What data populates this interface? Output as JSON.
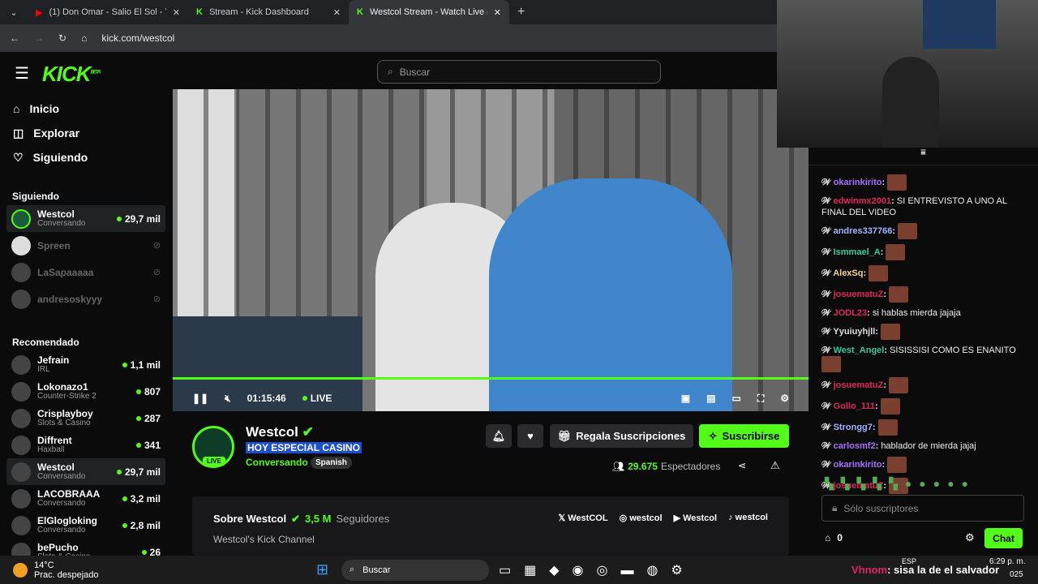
{
  "browser": {
    "tabs": [
      {
        "title": "(1) Don Omar - Salio El Sol - Yo",
        "icon": "youtube-icon"
      },
      {
        "title": "Stream - Kick Dashboard",
        "icon": "kick-icon"
      },
      {
        "title": "Westcol Stream - Watch Live on Kick",
        "icon": "kick-icon"
      }
    ],
    "url": "kick.com/westcol"
  },
  "header": {
    "logo": "KICK",
    "beta": "BETA",
    "search_placeholder": "Buscar"
  },
  "sidebar": {
    "nav": [
      {
        "label": "Inicio",
        "icon": "home-icon"
      },
      {
        "label": "Explorar",
        "icon": "compass-icon"
      },
      {
        "label": "Siguiendo",
        "icon": "heart-icon"
      }
    ],
    "following_title": "Siguiendo",
    "following": [
      {
        "name": "Westcol",
        "category": "Conversando",
        "viewers": "29,7 mil",
        "live": true
      },
      {
        "name": "Spreen",
        "live": false
      },
      {
        "name": "LaSapaaaaa",
        "live": false
      },
      {
        "name": "andresoskyyy",
        "live": false
      }
    ],
    "recommended_title": "Recomendado",
    "recommended": [
      {
        "name": "Jefrain",
        "category": "IRL",
        "viewers": "1,1 mil"
      },
      {
        "name": "Lokonazo1",
        "category": "Counter-Strike 2",
        "viewers": "807"
      },
      {
        "name": "Crisplayboy",
        "category": "Slots & Casino",
        "viewers": "287"
      },
      {
        "name": "Diffrent",
        "category": "Haxball",
        "viewers": "341"
      },
      {
        "name": "Westcol",
        "category": "Conversando",
        "viewers": "29,7 mil"
      },
      {
        "name": "LACOBRAAA",
        "category": "Conversando",
        "viewers": "3,2 mil"
      },
      {
        "name": "ElGlogloking",
        "category": "Conversando",
        "viewers": "2,8 mil"
      },
      {
        "name": "bePucho",
        "category": "Slots & Casino",
        "viewers": "26"
      }
    ]
  },
  "player": {
    "time": "01:15:46",
    "live": "LIVE",
    "progress_percent": 100
  },
  "stream": {
    "channel": "Westcol",
    "title": "HOY ESPECIAL CASINO",
    "category": "Conversando",
    "language": "Spanish",
    "live_badge": "LIVE",
    "gift_label": "Regala Suscripciones",
    "subscribe_label": "Suscribirse",
    "viewers": "29.675",
    "viewers_label": "Espectadores"
  },
  "about": {
    "title": "Sobre Westcol",
    "followers": "3,5 M",
    "followers_label": "Seguidores",
    "description": "Westcol's Kick Channel",
    "socials": [
      {
        "icon": "x-icon",
        "label": "WestCOL"
      },
      {
        "icon": "instagram-icon",
        "label": "westcol"
      },
      {
        "icon": "youtube-icon",
        "label": "Westcol"
      },
      {
        "icon": "tiktok-icon",
        "label": "westcol"
      }
    ]
  },
  "chat": {
    "messages": [
      {
        "user": "okarinkirito",
        "color": "#a970ff",
        "text": "",
        "emote": true
      },
      {
        "user": "edwinmx2001",
        "color": "#e0245e",
        "text": "SI ENTREVISTO A UNO AL FINAL DEL VIDEO",
        "emote": false
      },
      {
        "user": "andres337766",
        "color": "#a0b4ff",
        "text": "",
        "emote": true
      },
      {
        "user": "Ismmael_A",
        "color": "#2ecc9a",
        "text": "",
        "emote": true
      },
      {
        "user": "AlexSq",
        "color": "#f5d08a",
        "text": "",
        "emote": true
      },
      {
        "user": "josuematuZ",
        "color": "#e0245e",
        "text": "",
        "emote": true
      },
      {
        "user": "JODL23",
        "color": "#e0245e",
        "text": "si hablas mierda jajaja",
        "emote": false
      },
      {
        "user": "Yyuiuyhjll",
        "color": "#ddd",
        "text": "",
        "emote": true
      },
      {
        "user": "West_Angel",
        "color": "#2ecc9a",
        "text": "SISISSISI COMO ES ENANITO",
        "emote": true
      },
      {
        "user": "josuematuZ",
        "color": "#e0245e",
        "text": "",
        "emote": true
      },
      {
        "user": "Gollo_111",
        "color": "#e0245e",
        "text": "",
        "emote": true
      },
      {
        "user": "Strongg7",
        "color": "#a0b4ff",
        "text": "",
        "emote": true
      },
      {
        "user": "carlosmf2",
        "color": "#a970ff",
        "text": "hablador de mierda jajaj",
        "emote": false
      },
      {
        "user": "okarinkirito",
        "color": "#a970ff",
        "text": "",
        "emote": true
      },
      {
        "user": "josuematuZ",
        "color": "#e0245e",
        "text": "",
        "emote": true
      }
    ],
    "input_placeholder": "Sólo suscriptores",
    "points": "0",
    "send_label": "Chat"
  },
  "taskbar": {
    "weather_temp": "14°C",
    "weather_desc": "Prac. despejado",
    "search": "Buscar",
    "lang": "ESP",
    "time": "6:29 p. m.",
    "date_partial": "025",
    "overlay_user": "Vhnom",
    "overlay_text": ": sisa la de el salvador"
  },
  "colors": {
    "accent": "#53fc18",
    "background": "#0b0b0c"
  }
}
